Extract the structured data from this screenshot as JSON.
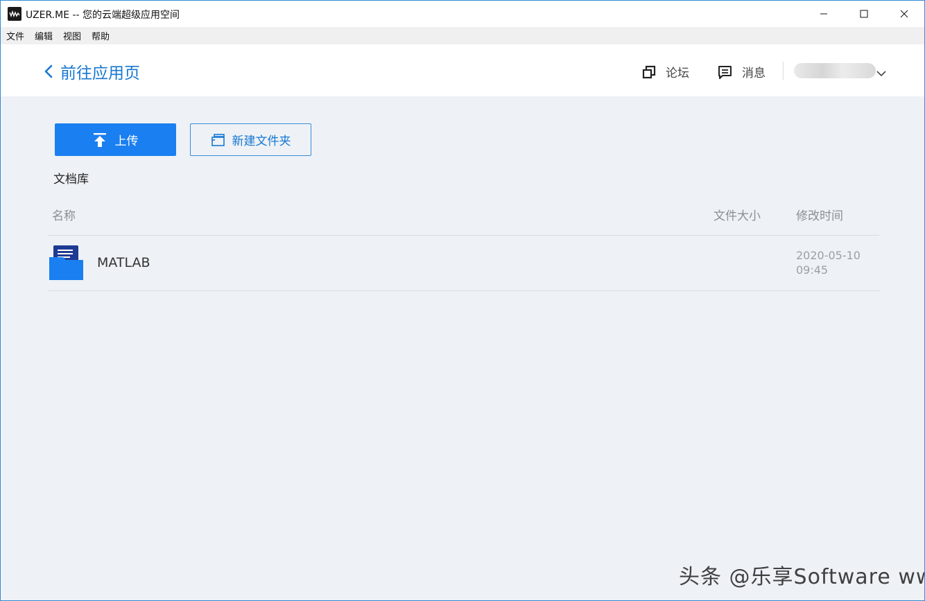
{
  "window": {
    "title": "UZER.ME -- 您的云端超级应用空间",
    "minimize_icon": "minimize-icon",
    "maximize_icon": "maximize-icon",
    "close_icon": "close-icon"
  },
  "menubar": {
    "items": [
      "文件",
      "编辑",
      "视图",
      "帮助"
    ]
  },
  "header": {
    "back_label": "前往应用页",
    "forum_label": "论坛",
    "messages_label": "消息",
    "accent": "#1677d2"
  },
  "toolbar": {
    "upload_label": "上传",
    "new_folder_label": "新建文件夹",
    "upload_color": "#1a7ff0"
  },
  "library": {
    "title": "文档库",
    "columns": {
      "name": "名称",
      "size": "文件大小",
      "modified": "修改时间"
    },
    "rows": [
      {
        "name": "MATLAB",
        "size": "",
        "date": "2020-05-10",
        "time": "09:45",
        "icon": "folder-icon"
      }
    ]
  },
  "watermark": "头条 @乐享Software www.rjtj.cn软荐网"
}
